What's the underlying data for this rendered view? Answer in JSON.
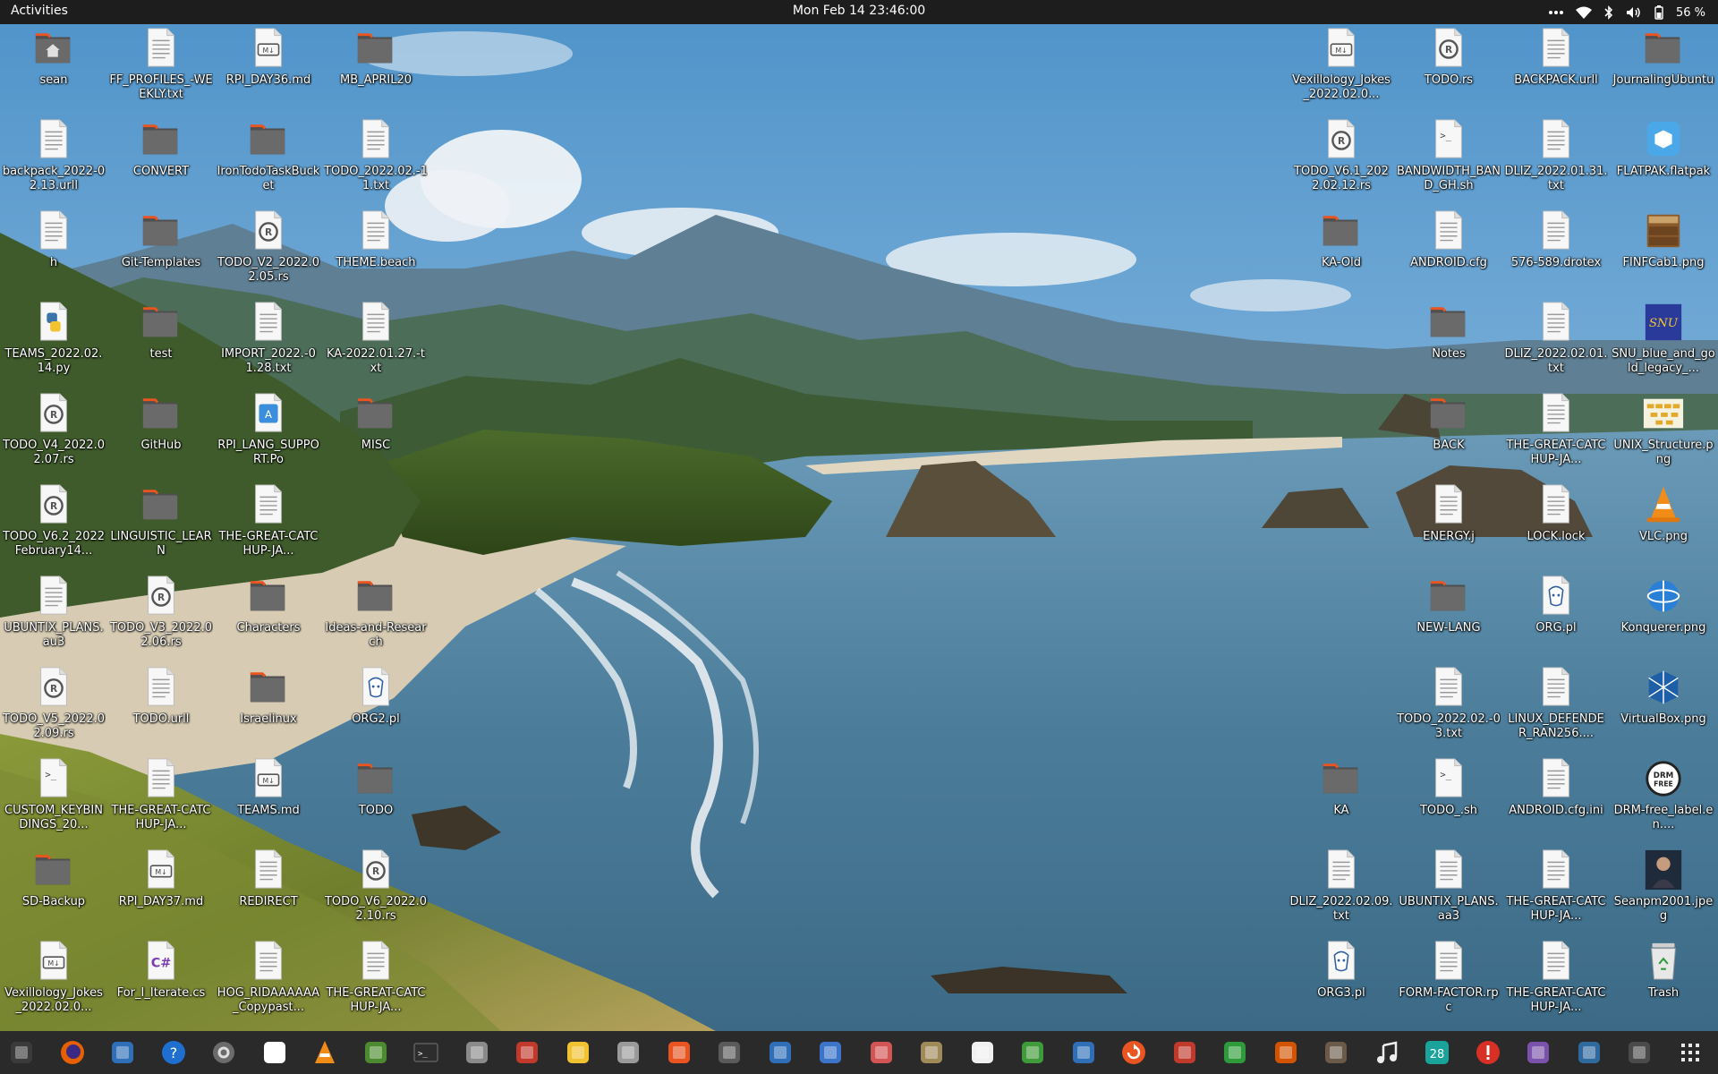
{
  "topbar": {
    "activities": "Activities",
    "clock": "Mon Feb 14  23:46:00",
    "battery": "56 %",
    "tray_icons": [
      "overflow-dots-icon",
      "wifi-icon",
      "bluetooth-icon",
      "volume-icon",
      "battery-icon"
    ]
  },
  "desktop": {
    "icons": [
      {
        "label": "sean",
        "type": "home-folder"
      },
      {
        "label": "FF_PROFILES_-WEEKLY.txt",
        "type": "text"
      },
      {
        "label": "RPI_DAY36.md",
        "type": "markdown"
      },
      {
        "label": "MB_APRIL20",
        "type": "folder"
      },
      {
        "label": "backpack_2022-02.13.urll",
        "type": "text"
      },
      {
        "label": "CONVERT",
        "type": "folder"
      },
      {
        "label": "IronTodoTaskBucket",
        "type": "folder"
      },
      {
        "label": "TODO_2022.02.-11.txt",
        "type": "text"
      },
      {
        "label": "h",
        "type": "text"
      },
      {
        "label": "Git-Templates",
        "type": "folder"
      },
      {
        "label": "TODO_V2_2022.02.05.rs",
        "type": "rust"
      },
      {
        "label": "THEME.beach",
        "type": "text"
      },
      {
        "label": "TEAMS_2022.02.14.py",
        "type": "python"
      },
      {
        "label": "test",
        "type": "folder"
      },
      {
        "label": "IMPORT_2022.-01.28.txt",
        "type": "text"
      },
      {
        "label": "KA-2022.01.27.-txt",
        "type": "text"
      },
      {
        "label": "TODO_V4_2022.02.07.rs",
        "type": "rust"
      },
      {
        "label": "GitHub",
        "type": "folder"
      },
      {
        "label": "RPI_LANG_SUPPORT.Po",
        "type": "translation"
      },
      {
        "label": "MISC",
        "type": "folder"
      },
      {
        "label": "TODO_V6.2_2022February14...",
        "type": "rust"
      },
      {
        "label": "LINGUISTIC_LEARN",
        "type": "folder"
      },
      {
        "label": "THE-GREAT-CATCHUP-JA...",
        "type": "text"
      },
      {
        "label": "UBUNTIX_PLANS.au3",
        "type": "text"
      },
      {
        "label": "TODO_V3_2022.02.06.rs",
        "type": "rust"
      },
      {
        "label": "Characters",
        "type": "folder"
      },
      {
        "label": "Ideas-and-Research",
        "type": "folder"
      },
      {
        "label": "TODO_V5_2022.02.09.rs",
        "type": "rust"
      },
      {
        "label": "TODO.urll",
        "type": "text"
      },
      {
        "label": "Israelinux",
        "type": "folder"
      },
      {
        "label": "ORG2.pl",
        "type": "perl"
      },
      {
        "label": "CUSTOM_KEYBINDINGS_20...",
        "type": "script"
      },
      {
        "label": "THE-GREAT-CATCHUP-JA...",
        "type": "text"
      },
      {
        "label": "TEAMS.md",
        "type": "markdown"
      },
      {
        "label": "TODO",
        "type": "folder"
      },
      {
        "label": "SD-Backup",
        "type": "folder"
      },
      {
        "label": "RPI_DAY37.md",
        "type": "markdown"
      },
      {
        "label": "REDIRECT",
        "type": "text"
      },
      {
        "label": "TODO_V6_2022.02.10.rs",
        "type": "rust"
      },
      {
        "label": "Vexillology_Jokes_2022.02.0...",
        "type": "markdown"
      },
      {
        "label": "For_I_Iterate.cs",
        "type": "csharp"
      },
      {
        "label": "HOG_RIDAAAAAA_Copypast...",
        "type": "text"
      },
      {
        "label": "THE-GREAT-CATCHUP-JA...",
        "type": "text"
      },
      {
        "label": "Vexillology_Jokes_2022.02.0...",
        "type": "markdown"
      },
      {
        "label": "TODO.rs",
        "type": "rust"
      },
      {
        "label": "BACKPACK.urll",
        "type": "text"
      },
      {
        "label": "JournalingUbuntu",
        "type": "folder"
      },
      {
        "label": "TODO_V6.1_2022.02.12.rs",
        "type": "rust"
      },
      {
        "label": "BANDWIDTH_BAND_GH.sh",
        "type": "script"
      },
      {
        "label": "DLIZ_2022.01.31.txt",
        "type": "text"
      },
      {
        "label": "FLATPAK.flatpak",
        "type": "flatpak"
      },
      {
        "label": "KA-Old",
        "type": "folder"
      },
      {
        "label": "ANDROID.cfg",
        "type": "text"
      },
      {
        "label": "576-589.drotex",
        "type": "text"
      },
      {
        "label": "FINFCab1.png",
        "type": "image-cabinet"
      },
      {
        "label": "Notes",
        "type": "folder"
      },
      {
        "label": "DLIZ_2022.02.01.txt",
        "type": "text"
      },
      {
        "label": "SNU_blue_and_gold_legacy_...",
        "type": "image-snu"
      },
      {
        "label": "BACK",
        "type": "folder"
      },
      {
        "label": "THE-GREAT-CATCHUP-JA...",
        "type": "text"
      },
      {
        "label": "UNIX_Structure.png",
        "type": "image-unix"
      },
      {
        "label": "ENERGY.j",
        "type": "text"
      },
      {
        "label": "LOCK.lock",
        "type": "text"
      },
      {
        "label": "VLC.png",
        "type": "image-vlc"
      },
      {
        "label": "NEW-LANG",
        "type": "folder"
      },
      {
        "label": "ORG.pl",
        "type": "perl"
      },
      {
        "label": "Konquerer.png",
        "type": "image-konqueror"
      },
      {
        "label": "TODO_2022.02.-03.txt",
        "type": "text"
      },
      {
        "label": "LINUX_DEFENDER_RAN256....",
        "type": "text"
      },
      {
        "label": "VirtualBox.png",
        "type": "image-virtualbox"
      },
      {
        "label": "KA",
        "type": "folder"
      },
      {
        "label": "TODO_.sh",
        "type": "script"
      },
      {
        "label": "ANDROID.cfg.ini",
        "type": "text"
      },
      {
        "label": "DRM-free_label.en....",
        "type": "image-drm"
      },
      {
        "label": "DLIZ_2022.02.09.txt",
        "type": "text"
      },
      {
        "label": "UBUNTIX_PLANS.aa3",
        "type": "text"
      },
      {
        "label": "THE-GREAT-CATCHUP-JA...",
        "type": "text"
      },
      {
        "label": "Seanpm2001.jpeg",
        "type": "image-photo"
      },
      {
        "label": "ORG3.pl",
        "type": "perl"
      },
      {
        "label": "FORM-FACTOR.rpc",
        "type": "text"
      },
      {
        "label": "THE-GREAT-CATCHUP-JA...",
        "type": "text"
      },
      {
        "label": "Trash",
        "type": "trash"
      }
    ]
  },
  "dock": {
    "apps": [
      "system-monitor-icon",
      "firefox-icon",
      "document-viewer-icon",
      "help-icon",
      "settings-icon",
      "text-editor-icon",
      "vlc-icon",
      "minecraft-icon",
      "terminal-icon",
      "files-icon",
      "activity-graph-icon",
      "calculator-icon",
      "image-viewer-icon",
      "software-center-icon",
      "disk-utility-icon",
      "screenshot-tool-icon",
      "tasks-icon",
      "presentation-icon",
      "archive-manager-icon",
      "character-map-icon",
      "vim-icon",
      "remote-desktop-icon",
      "software-updater-icon",
      "pdf-viewer-icon",
      "spreadsheet-icon",
      "game-icon",
      "gimp-icon",
      "music-icon",
      "calendar-icon",
      "alert-icon",
      "screen-recorder-icon",
      "photo-editor-icon",
      "app-store-icon",
      "show-apps-grid-icon"
    ],
    "calendar_day": "28"
  },
  "colors": {
    "topbar_bg": "#1d1d1d",
    "dock_bg": "#2a2a2a",
    "folder_tab": "#4f4f4f",
    "folder_body": "#6a6a6a",
    "folder_accent": "#e95420",
    "file_paper": "#f7f7f7"
  }
}
